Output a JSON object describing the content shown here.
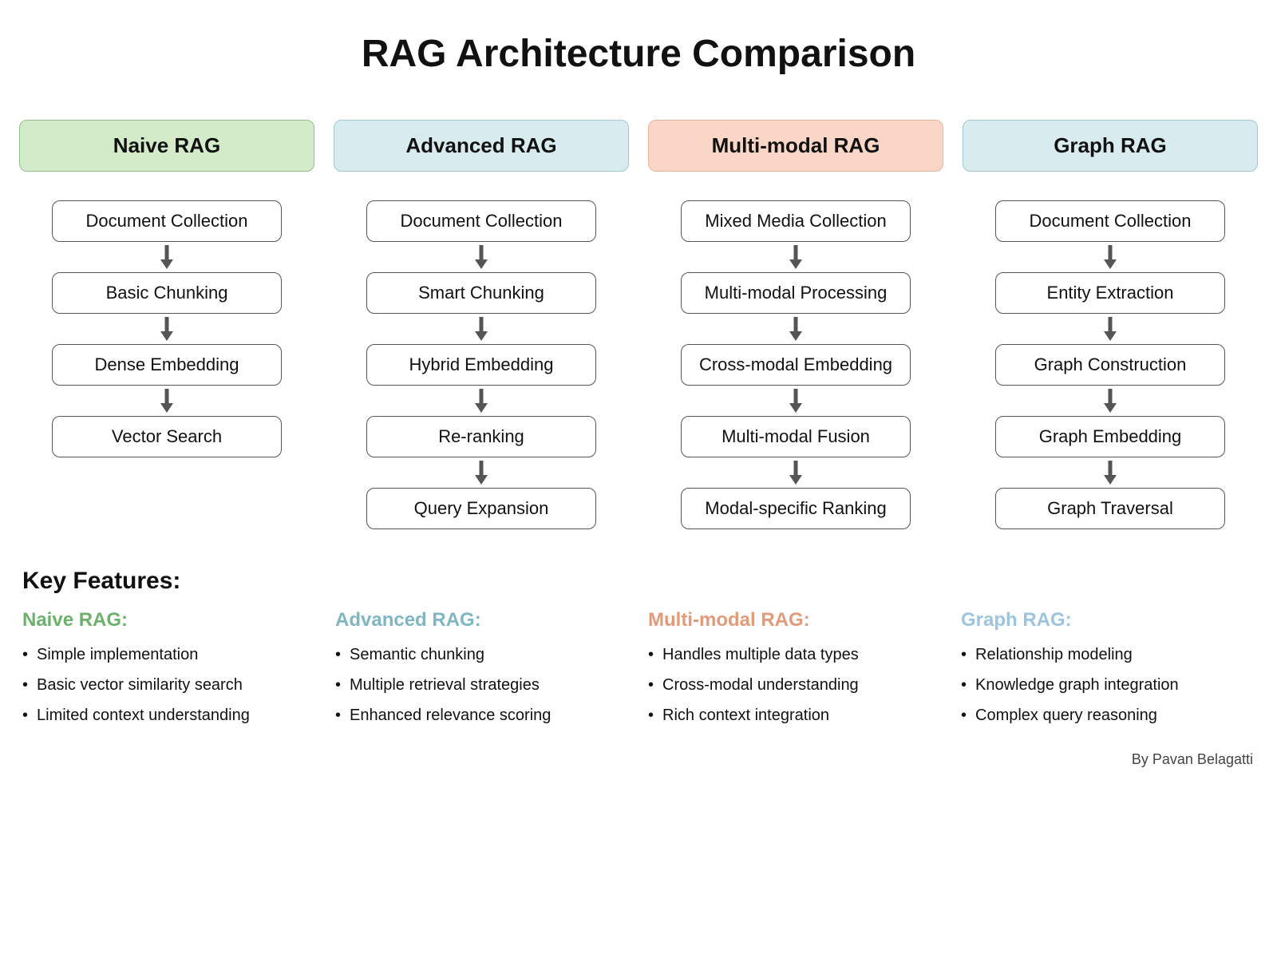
{
  "title": "RAG Architecture Comparison",
  "columns": [
    {
      "name": "Naive RAG",
      "header_class": "hdr-green",
      "steps": [
        "Document Collection",
        "Basic Chunking",
        "Dense Embedding",
        "Vector Search"
      ]
    },
    {
      "name": "Advanced RAG",
      "header_class": "hdr-blue",
      "steps": [
        "Document Collection",
        "Smart Chunking",
        "Hybrid Embedding",
        "Re-ranking",
        "Query Expansion"
      ]
    },
    {
      "name": "Multi-modal RAG",
      "header_class": "hdr-orange",
      "steps": [
        "Mixed Media Collection",
        "Multi-modal Processing",
        "Cross-modal Embedding",
        "Multi-modal Fusion",
        "Modal-specific Ranking"
      ]
    },
    {
      "name": "Graph RAG",
      "header_class": "hdr-blue",
      "steps": [
        "Document Collection",
        "Entity Extraction",
        "Graph Construction",
        "Graph Embedding",
        "Graph Traversal"
      ]
    }
  ],
  "features_heading": "Key Features:",
  "features": [
    {
      "title": "Naive RAG:",
      "title_class": "t-green",
      "items": [
        "Simple implementation",
        "Basic vector similarity search",
        "Limited context understanding"
      ]
    },
    {
      "title": "Advanced RAG:",
      "title_class": "t-blue",
      "items": [
        "Semantic chunking",
        "Multiple retrieval strategies",
        "Enhanced relevance scoring"
      ]
    },
    {
      "title": "Multi-modal RAG:",
      "title_class": "t-orange",
      "items": [
        "Handles multiple data types",
        "Cross-modal understanding",
        "Rich context integration"
      ]
    },
    {
      "title": "Graph RAG:",
      "title_class": "t-lblue",
      "items": [
        "Relationship modeling",
        "Knowledge graph integration",
        "Complex query reasoning"
      ]
    }
  ],
  "byline": "By Pavan Belagatti"
}
